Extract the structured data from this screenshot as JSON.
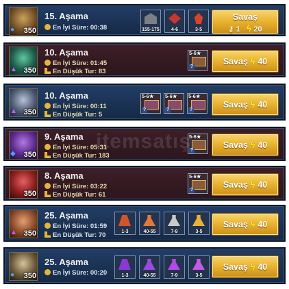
{
  "rows": [
    {
      "stage": "15. Aşama",
      "best": "En İyi Süre: 00:38",
      "level": "350",
      "rewards": [
        "155-175",
        "4-6",
        "3-5"
      ],
      "button": {
        "label": "Savaş",
        "keys": "1",
        "energy": "20"
      }
    },
    {
      "stage": "10. Aşama",
      "best": "En İyi Süre: 01:45",
      "turns": "En Düşük Tur: 83",
      "level": "350",
      "chest_rank": "5-6★",
      "button": {
        "label": "Savaş",
        "energy": "40"
      }
    },
    {
      "stage": "10. Aşama",
      "best": "En İyi Süre: 00:11",
      "turns": "En Düşük Tur: 5",
      "level": "350",
      "chest_ranks": [
        "5-6★",
        "5-6★",
        "5-6★"
      ],
      "button": {
        "label": "Savaş",
        "energy": "40"
      }
    },
    {
      "stage": "9. Aşama",
      "best": "En İyi Süre: 05:31",
      "turns": "En Düşük Tur: 183",
      "level": "350",
      "chest_rank": "5-6★",
      "button": {
        "label": "Savaş",
        "energy": "40"
      }
    },
    {
      "stage": "8. Aşama",
      "best": "En İyi Süre: 03:22",
      "turns": "En Düşük Tur: 61",
      "level": "350",
      "chest_rank": "5-6★",
      "button": {
        "label": "Savaş",
        "energy": "40"
      }
    },
    {
      "stage": "25. Aşama",
      "best": "En İyi Süre: 01:59",
      "turns": "En Düşük Tur: 70",
      "level": "350",
      "rewards": [
        "1-3",
        "40-55",
        "7-9",
        "3-5"
      ],
      "button": {
        "label": "Savaş",
        "energy": "40"
      }
    },
    {
      "stage": "25. Aşama",
      "best": "En İyi Süre: 00:20",
      "level": "350",
      "rewards": [
        "1-3",
        "40-55",
        "7-9",
        "3-5"
      ],
      "button": {
        "label": "Savaş",
        "energy": "40"
      }
    }
  ],
  "chest_question": "?",
  "watermark": "itemsatış"
}
